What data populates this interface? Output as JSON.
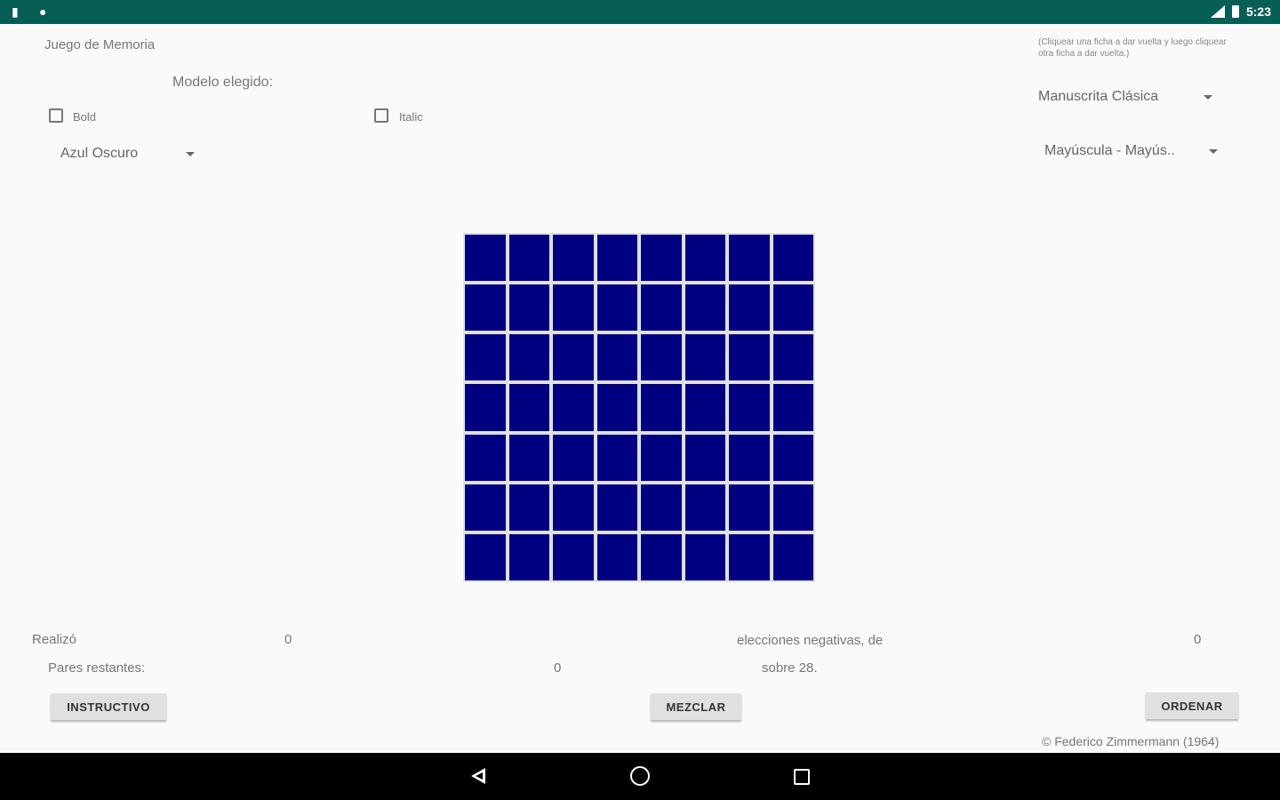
{
  "header": {
    "app_title": "Juego de Memoria",
    "instruction": "(Cliquear una ficha a dar vuelta y luego cliquear otra ficha a dar vuelta.)",
    "model_label": "Modelo elegido:"
  },
  "options": {
    "bold_label": "Bold",
    "italic_label": "Italic",
    "color_select": "Azul Oscuro",
    "font_select": "Manuscrita Clásica",
    "case_select": "Mayúscula - Mayús.."
  },
  "board": {
    "rows": 7,
    "cols": 8,
    "tile_color": "#000080"
  },
  "stats": {
    "made_label": "Realizó",
    "made_value": "0",
    "negative_label": "elecciones negativas, de",
    "negative_value": "0",
    "pairs_label": "Pares restantes:",
    "pairs_value": "0",
    "total_label": "sobre 28."
  },
  "buttons": {
    "instructivo": "INSTRUCTIVO",
    "mezclar": "MEZCLAR",
    "ordenar": "ORDENAR"
  },
  "footer": {
    "copyright": "© Federico Zimmermann (1964)"
  },
  "statusbar": {
    "time": "5:23"
  },
  "colors": {
    "statusbar": "#075e54",
    "tile": "#000080",
    "background": "#fafafa"
  }
}
